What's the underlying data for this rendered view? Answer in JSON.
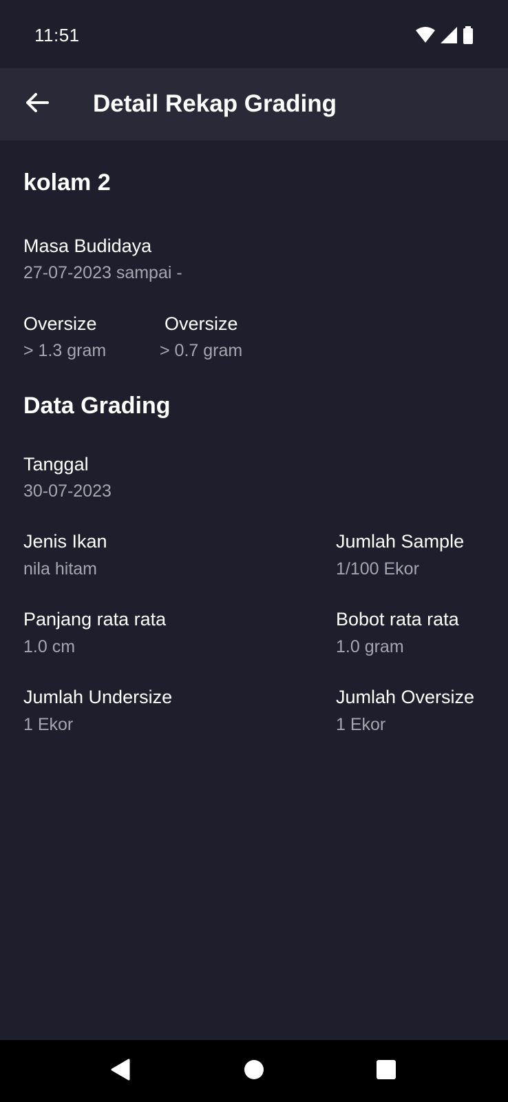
{
  "status_bar": {
    "time": "11:51",
    "icons": [
      "wifi-icon",
      "cellular-signal-icon",
      "battery-icon"
    ]
  },
  "app_bar": {
    "title": "Detail Rekap Grading",
    "back_icon": "arrow-left-icon"
  },
  "pond": {
    "name": "kolam 2",
    "masa_budidaya_label": "Masa Budidaya",
    "masa_budidaya_value": "27-07-2023 sampai -",
    "oversize_1_label": "Oversize",
    "oversize_1_value": "> 1.3 gram",
    "oversize_2_label": "Oversize",
    "oversize_2_value": "> 0.7 gram"
  },
  "grading": {
    "section_title": "Data Grading",
    "tanggal_label": "Tanggal",
    "tanggal_value": "30-07-2023",
    "jenis_ikan_label": "Jenis Ikan",
    "jenis_ikan_value": "nila hitam",
    "jumlah_sample_label": "Jumlah Sample",
    "jumlah_sample_value": "1/100 Ekor",
    "panjang_label": "Panjang rata rata",
    "panjang_value": "1.0 cm",
    "bobot_label": "Bobot rata rata",
    "bobot_value": "1.0 gram",
    "undersize_label": "Jumlah Undersize",
    "undersize_value": "1 Ekor",
    "oversize_label": "Jumlah Oversize",
    "oversize_value": "1 Ekor"
  },
  "nav_bar": {
    "buttons": [
      "back-triangle-icon",
      "home-circle-icon",
      "recents-square-icon"
    ]
  },
  "colors": {
    "background": "#1f1e2c",
    "app_bar": "#2a2938",
    "text_primary": "#ffffff",
    "text_secondary": "#a7a6b0",
    "nav_bar": "#000000"
  }
}
